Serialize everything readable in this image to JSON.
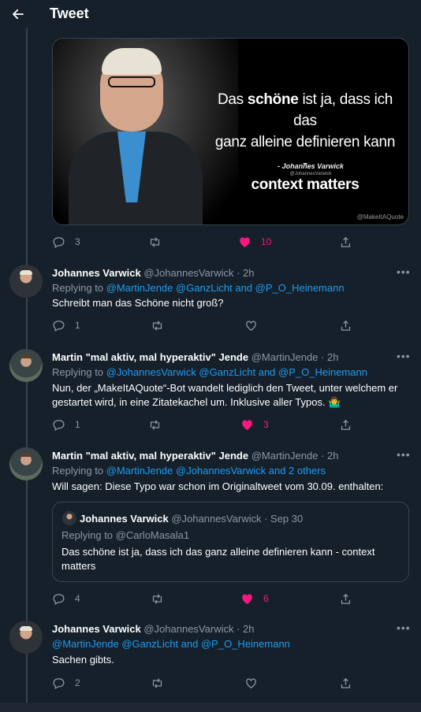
{
  "header": {
    "title": "Tweet"
  },
  "image_card": {
    "quote_pre": "Das",
    "quote_bold": "schöne",
    "quote_line1_post": " ist ja, dass ich das",
    "quote_line2": "ganz alleine definieren kann -",
    "quote_line3": "context matters",
    "author": "- Johannes Varwick",
    "author_handle": "@JohannesVarwick",
    "watermark": "@MakeItAQuote"
  },
  "main_actions": {
    "replies": "3",
    "retweets": "",
    "likes": "10"
  },
  "tweets": [
    {
      "name": "Johannes Varwick",
      "meta": " @JohannesVarwick · 2h",
      "reply_prefix": "Replying to ",
      "reply_to": "@MartinJende @GanzLicht and @P_O_Heinemann",
      "text": "Schreibt man das Schöne nicht groß?",
      "replies": "1",
      "retweets": "",
      "likes": ""
    },
    {
      "name": "Martin \"mal aktiv, mal hyperaktiv\" Jende",
      "meta": " @MartinJende · 2h",
      "reply_prefix": "Replying to ",
      "reply_to": "@JohannesVarwick @GanzLicht and @P_O_Heinemann",
      "text": "Nun, der „MakeItAQuote“-Bot wandelt lediglich den Tweet, unter welchem er gestartet wird, in eine Zitatekachel um. Inklusive aller Typos. 🤷‍♂️",
      "replies": "1",
      "retweets": "",
      "likes": "3"
    },
    {
      "name": "Martin \"mal aktiv, mal hyperaktiv\" Jende",
      "meta": " @MartinJende · 2h",
      "reply_prefix": "Replying to ",
      "reply_to": "@MartinJende @JohannesVarwick and 2 others",
      "text": "Will sagen: Diese Typo war schon im Originaltweet vom 30.09. enthalten:",
      "replies": "4",
      "retweets": "",
      "likes": "6",
      "embed": {
        "name": "Johannes Varwick",
        "meta": " @JohannesVarwick · Sep 30",
        "reply_prefix": "Replying to ",
        "reply_to": "@CarloMasala1",
        "text": "Das schöne ist ja, dass ich das ganz alleine definieren kann - context matters"
      }
    },
    {
      "name": "Johannes Varwick",
      "meta": " @JohannesVarwick · 2h",
      "reply_prefix": "",
      "reply_to": "@MartinJende @GanzLicht and @P_O_Heinemann",
      "text": "Sachen gibts.",
      "replies": "2",
      "retweets": "",
      "likes": ""
    }
  ],
  "more_label": "•••",
  "icons": [
    "back-arrow-icon",
    "reply-icon",
    "retweet-icon",
    "like-icon",
    "share-icon",
    "more-icon"
  ],
  "colors": {
    "background": "#15202b",
    "link": "#1d9bf0",
    "like": "#f91880",
    "muted": "#8b98a5"
  }
}
